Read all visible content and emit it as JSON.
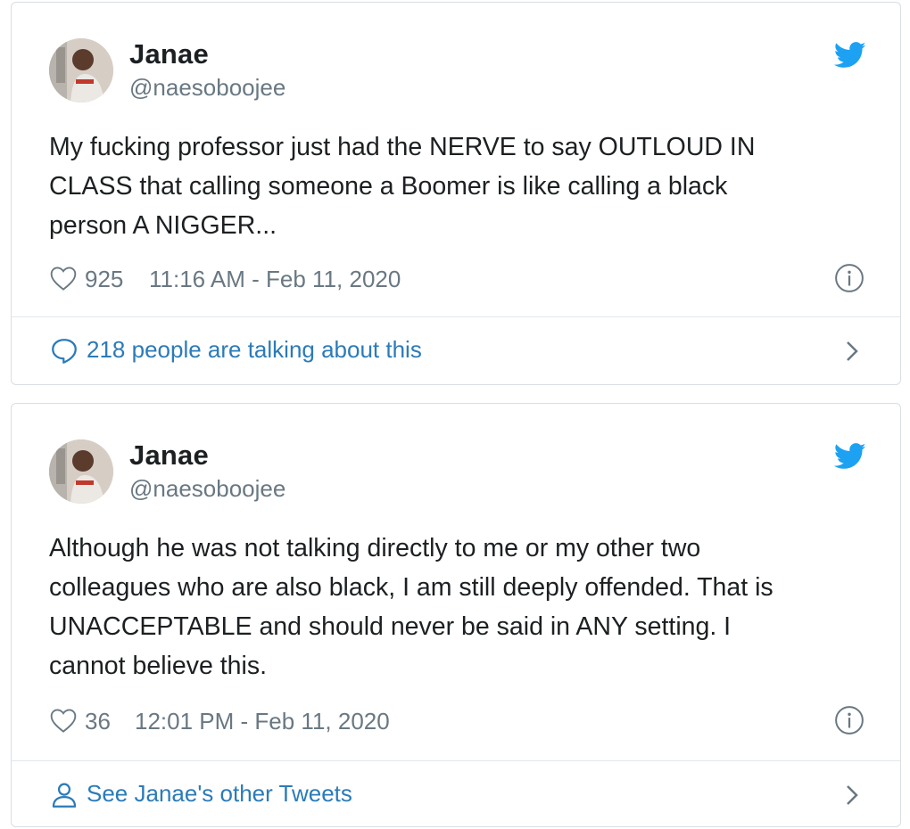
{
  "tweets": [
    {
      "author": {
        "name": "Janae",
        "handle": "@naesoboojee"
      },
      "text": "My fucking professor just had the NERVE to say OUTLOUD IN\nCLASS that calling someone a Boomer is like calling a black\nperson A NIGGER...",
      "likes": "925",
      "timestamp": "11:16 AM - Feb 11, 2020",
      "footer": {
        "label": "218 people are talking about this",
        "icon": "comment-bubble-icon"
      }
    },
    {
      "author": {
        "name": "Janae",
        "handle": "@naesoboojee"
      },
      "text": "Although he was not talking directly to me or my other two\ncolleagues who are also black, I am still deeply offended. That is\nUNACCEPTABLE and should never be said in ANY setting. I\ncannot believe this.",
      "likes": "36",
      "timestamp": "12:01 PM - Feb 11, 2020",
      "footer": {
        "label": "See Janae's other Tweets",
        "icon": "person-icon"
      }
    }
  ],
  "colors": {
    "twitter_blue": "#1da1f2",
    "link_blue": "#2b7bb9",
    "text": "#1c2022",
    "muted": "#697882",
    "border": "#d8dee3"
  }
}
